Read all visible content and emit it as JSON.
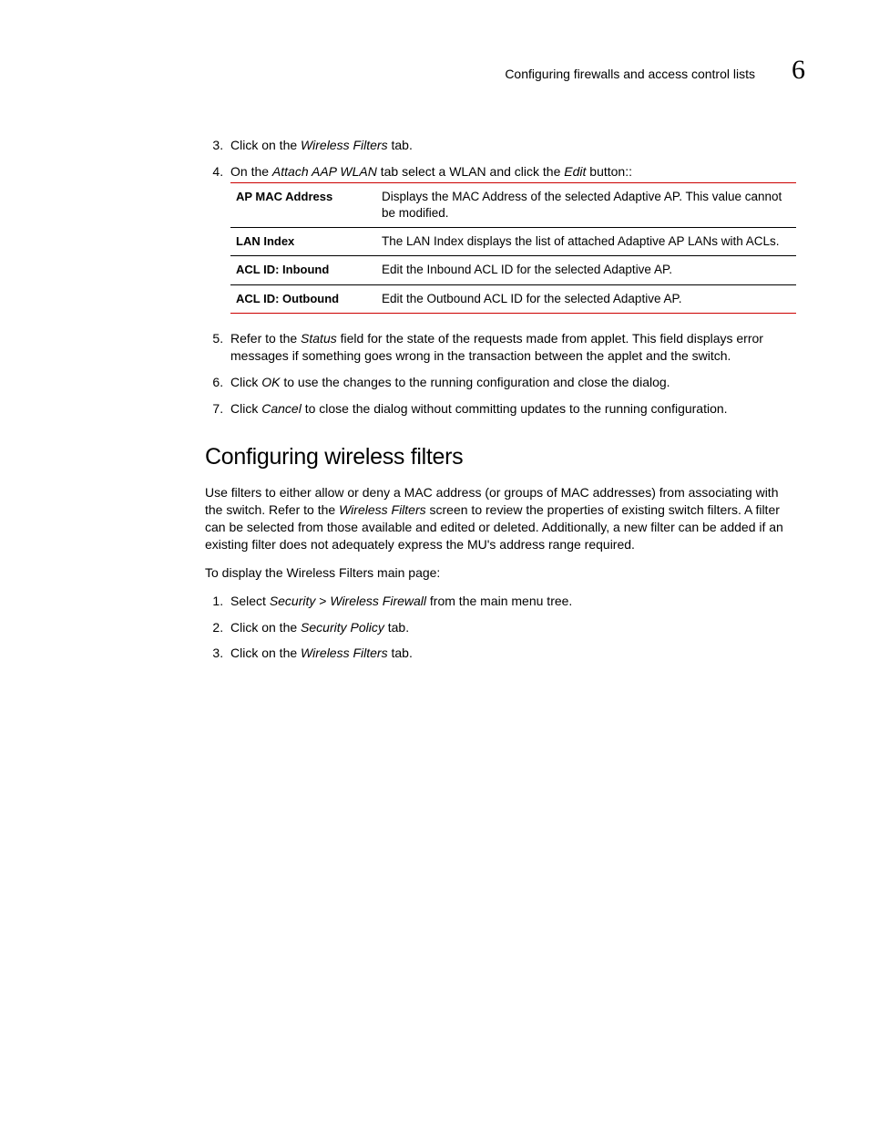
{
  "header": {
    "title": "Configuring firewalls and access control lists",
    "chapter_number": "6"
  },
  "steps_a": {
    "s3": {
      "prefix": "Click on the ",
      "em": "Wireless Filters",
      "suffix": " tab."
    },
    "s4": {
      "prefix": "On the ",
      "em1": "Attach AAP WLAN",
      "mid": " tab select a WLAN and click the ",
      "em2": "Edit",
      "suffix": " button::"
    }
  },
  "table": {
    "r1": {
      "label": "AP MAC Address",
      "desc": "Displays the MAC Address of the selected Adaptive AP. This value cannot be modified."
    },
    "r2": {
      "label": "LAN Index",
      "desc": "The LAN Index displays the list of attached Adaptive AP LANs with ACLs."
    },
    "r3": {
      "label": "ACL ID: Inbound",
      "desc": "Edit the Inbound ACL ID for the selected Adaptive AP."
    },
    "r4": {
      "label": "ACL ID: Outbound",
      "desc": "Edit the Outbound ACL ID for the selected Adaptive AP."
    }
  },
  "steps_b": {
    "s5": {
      "prefix": "Refer to the ",
      "em": "Status",
      "suffix": " field for the state of the requests made from applet. This field displays error messages if something goes wrong in the transaction between the applet and the switch."
    },
    "s6": {
      "prefix": "Click ",
      "em": "OK",
      "suffix": " to use the changes to the running configuration and close the dialog."
    },
    "s7": {
      "prefix": "Click ",
      "em": "Cancel",
      "suffix": " to close the dialog without committing updates to the running configuration."
    }
  },
  "section": {
    "heading": "Configuring wireless filters",
    "para1a": "Use filters to either allow or deny a MAC address (or groups of MAC addresses) from associating with the switch. Refer to the ",
    "para1em": "Wireless Filters",
    "para1b": " screen to review the properties of existing switch filters. A filter can be selected from those available and edited or deleted. Additionally, a new filter can be added if an existing filter does not adequately express the MU's address range required.",
    "para2": "To display the Wireless Filters main page:"
  },
  "steps_c": {
    "s1": {
      "prefix": "Select ",
      "em1": "Security",
      "mid": " > ",
      "em2": "Wireless Firewall",
      "suffix": " from the main menu tree."
    },
    "s2": {
      "prefix": "Click on the ",
      "em": "Security Policy",
      "suffix": " tab."
    },
    "s3": {
      "prefix": "Click on the ",
      "em": "Wireless Filters",
      "suffix": " tab."
    }
  }
}
